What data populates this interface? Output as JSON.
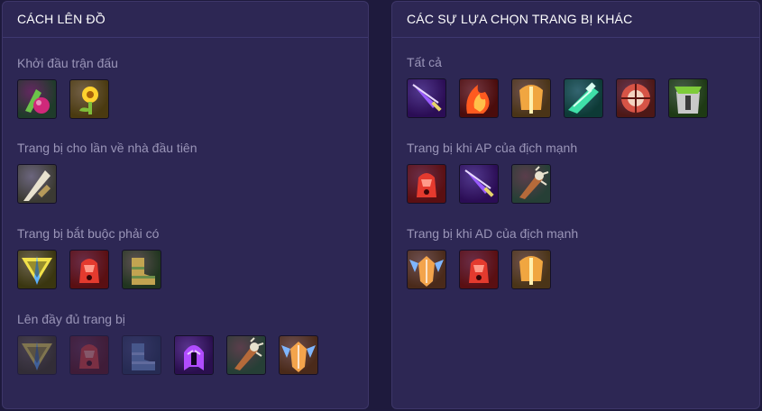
{
  "build": {
    "title": "CÁCH LÊN ĐỒ",
    "sections": [
      {
        "title": "Khởi đầu trận đấu",
        "items": [
          {
            "icon": "corrupting-potion-icon",
            "bg": "#1f3b2a",
            "fg": "#d0287a",
            "accent": "#6cc24a"
          },
          {
            "icon": "sunflower-amulet-icon",
            "bg": "#4a3a10",
            "fg": "#ffd22e",
            "accent": "#7fbf3a"
          }
        ]
      },
      {
        "title": "Trang bị cho lần về nhà đầu tiên",
        "items": [
          {
            "icon": "silver-blade-icon",
            "bg": "#3b3a33",
            "fg": "#e8e2cf",
            "accent": "#b59a5a"
          }
        ]
      },
      {
        "title": "Trang bị bắt buộc phải có",
        "items": [
          {
            "icon": "golden-sword-emblem-icon",
            "bg": "#3a3610",
            "fg": "#f2e24a",
            "accent": "#5ab0ff"
          },
          {
            "icon": "crimson-gauntlet-icon",
            "bg": "#5a0f12",
            "fg": "#e43a2e",
            "accent": "#ff9a8a"
          },
          {
            "icon": "bronze-boots-icon",
            "bg": "#20351f",
            "fg": "#c2a451",
            "accent": "#6b8e4a"
          }
        ]
      },
      {
        "title": "Lên đầy đủ trang bị",
        "items": [
          {
            "icon": "golden-sword-emblem-icon",
            "bg": "#3a3610",
            "fg": "#f2e24a",
            "accent": "#5ab0ff",
            "dim": true
          },
          {
            "icon": "crimson-gauntlet-icon",
            "bg": "#5a0f12",
            "fg": "#e43a2e",
            "accent": "#ff9a8a",
            "dim": true
          },
          {
            "icon": "bronze-boots-icon",
            "bg": "#1d3152",
            "fg": "#6b9ad8",
            "accent": "#a8c8ff",
            "dim": true
          },
          {
            "icon": "violet-helm-icon",
            "bg": "#2a0f4e",
            "fg": "#b04cff",
            "accent": "#e7c8ff"
          },
          {
            "icon": "spiked-club-icon",
            "bg": "#263f36",
            "fg": "#b56a3a",
            "accent": "#e8e2cf"
          },
          {
            "icon": "winged-shield-icon",
            "bg": "#4a2a1a",
            "fg": "#f3a44c",
            "accent": "#7fb6ff"
          }
        ]
      }
    ]
  },
  "alternatives": {
    "title": "CÁC SỰ LỰA CHỌN TRANG BỊ KHÁC",
    "sections": [
      {
        "title": "Tất cả",
        "items": [
          {
            "icon": "violet-blade-icon",
            "bg": "#2b0d55",
            "fg": "#9a5bff",
            "accent": "#e6d46a"
          },
          {
            "icon": "flame-axe-icon",
            "bg": "#4a0c0c",
            "fg": "#ff5a1f",
            "accent": "#ffc04a"
          },
          {
            "icon": "golden-hammer-icon",
            "bg": "#4a3417",
            "fg": "#f0a640",
            "accent": "#fff0b0"
          },
          {
            "icon": "emerald-rifle-icon",
            "bg": "#0d3a36",
            "fg": "#3fe0a8",
            "accent": "#d9fff0"
          },
          {
            "icon": "red-shield-icon",
            "bg": "#4d1816",
            "fg": "#d65446",
            "accent": "#f2d3c0"
          },
          {
            "icon": "green-armor-icon",
            "bg": "#1e3a14",
            "fg": "#7ecb3a",
            "accent": "#c9c9c9"
          }
        ]
      },
      {
        "title": "Trang bị khi AP của địch mạnh",
        "items": [
          {
            "icon": "crimson-gauntlet-icon",
            "bg": "#5a0f12",
            "fg": "#e43a2e",
            "accent": "#ff9a8a"
          },
          {
            "icon": "violet-blade-icon",
            "bg": "#2b0d55",
            "fg": "#9a5bff",
            "accent": "#e6d46a"
          },
          {
            "icon": "spiked-club-icon",
            "bg": "#263f36",
            "fg": "#b56a3a",
            "accent": "#e8e2cf"
          }
        ]
      },
      {
        "title": "Trang bị khi AD của địch mạnh",
        "items": [
          {
            "icon": "winged-shield-icon",
            "bg": "#4a2a1a",
            "fg": "#f3a44c",
            "accent": "#7fb6ff"
          },
          {
            "icon": "crimson-gauntlet-icon",
            "bg": "#5a0f12",
            "fg": "#e43a2e",
            "accent": "#ff9a8a"
          },
          {
            "icon": "golden-hammer-icon",
            "bg": "#4a3417",
            "fg": "#f0a640",
            "accent": "#fff0b0"
          }
        ]
      }
    ]
  }
}
